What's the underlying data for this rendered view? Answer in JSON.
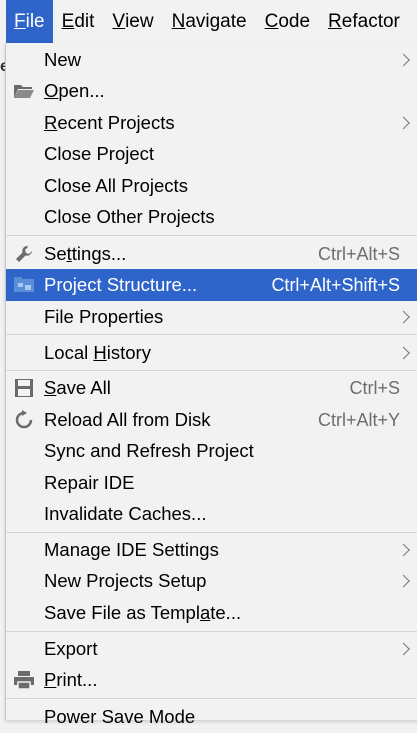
{
  "menubar": {
    "items": [
      {
        "pre": "",
        "u": "F",
        "post": "ile"
      },
      {
        "pre": "",
        "u": "E",
        "post": "dit"
      },
      {
        "pre": "",
        "u": "V",
        "post": "iew"
      },
      {
        "pre": "",
        "u": "N",
        "post": "avigate"
      },
      {
        "pre": "",
        "u": "C",
        "post": "ode"
      },
      {
        "pre": "",
        "u": "R",
        "post": "efactor"
      }
    ]
  },
  "background": {
    "hint_e": "e"
  },
  "menu": {
    "items": [
      {
        "pre": "New",
        "u": "",
        "post": "",
        "shortcut": "",
        "submenu": true,
        "icon": ""
      },
      {
        "pre": "",
        "u": "O",
        "post": "pen...",
        "shortcut": "",
        "submenu": false,
        "icon": "folder-open-icon"
      },
      {
        "pre": "",
        "u": "R",
        "post": "ecent Projects",
        "shortcut": "",
        "submenu": true,
        "icon": ""
      },
      {
        "pre": "Close Project",
        "u": "",
        "post": "",
        "shortcut": "",
        "submenu": false,
        "icon": ""
      },
      {
        "pre": "Close All Projects",
        "u": "",
        "post": "",
        "shortcut": "",
        "submenu": false,
        "icon": ""
      },
      {
        "pre": "Close Other Projects",
        "u": "",
        "post": "",
        "shortcut": "",
        "submenu": false,
        "icon": ""
      },
      {
        "pre": "Se",
        "u": "t",
        "post": "tings...",
        "shortcut": "Ctrl+Alt+S",
        "submenu": false,
        "icon": "wrench-icon"
      },
      {
        "pre": "Project Structure...",
        "u": "",
        "post": "",
        "shortcut": "Ctrl+Alt+Shift+S",
        "submenu": false,
        "icon": "project-structure-icon",
        "selected": true
      },
      {
        "pre": "File Properties",
        "u": "",
        "post": "",
        "shortcut": "",
        "submenu": true,
        "icon": ""
      },
      {
        "pre": "Local ",
        "u": "H",
        "post": "istory",
        "shortcut": "",
        "submenu": true,
        "icon": ""
      },
      {
        "pre": "",
        "u": "S",
        "post": "ave All",
        "shortcut": "Ctrl+S",
        "submenu": false,
        "icon": "save-icon"
      },
      {
        "pre": "Reload All from Disk",
        "u": "",
        "post": "",
        "shortcut": "Ctrl+Alt+Y",
        "submenu": false,
        "icon": "reload-icon"
      },
      {
        "pre": "Sync and Refresh Project",
        "u": "",
        "post": "",
        "shortcut": "",
        "submenu": false,
        "icon": ""
      },
      {
        "pre": "Repair IDE",
        "u": "",
        "post": "",
        "shortcut": "",
        "submenu": false,
        "icon": ""
      },
      {
        "pre": "Invalidate Caches...",
        "u": "",
        "post": "",
        "shortcut": "",
        "submenu": false,
        "icon": ""
      },
      {
        "pre": "Manage IDE Settings",
        "u": "",
        "post": "",
        "shortcut": "",
        "submenu": true,
        "icon": ""
      },
      {
        "pre": "New Projects Setup",
        "u": "",
        "post": "",
        "shortcut": "",
        "submenu": true,
        "icon": ""
      },
      {
        "pre": "Save File as Templ",
        "u": "a",
        "post": "te...",
        "shortcut": "",
        "submenu": false,
        "icon": ""
      },
      {
        "pre": "Export",
        "u": "",
        "post": "",
        "shortcut": "",
        "submenu": true,
        "icon": ""
      },
      {
        "pre": "",
        "u": "P",
        "post": "rint...",
        "shortcut": "",
        "submenu": false,
        "icon": "print-icon"
      },
      {
        "pre": "Power Save Mode",
        "u": "",
        "post": "",
        "shortcut": "",
        "submenu": false,
        "icon": ""
      }
    ]
  }
}
